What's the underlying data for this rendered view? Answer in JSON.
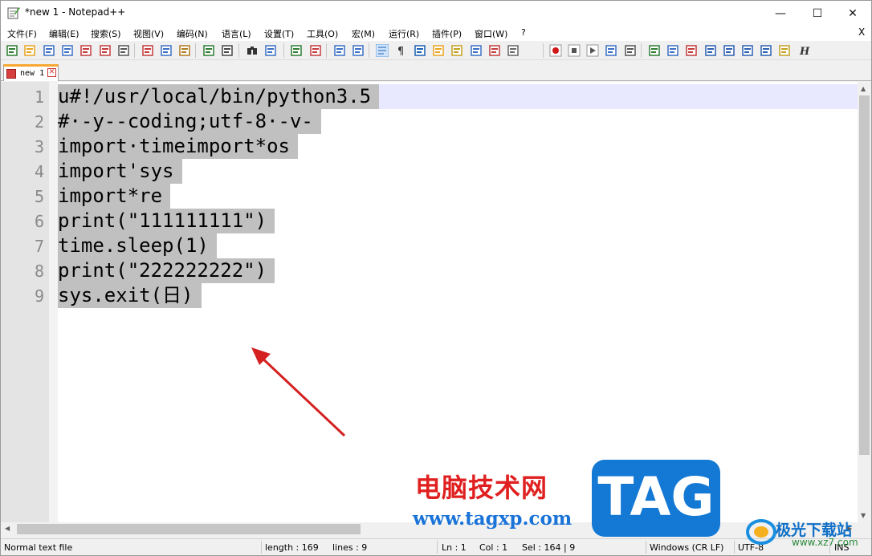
{
  "window": {
    "title": "*new 1 - Notepad++",
    "minimize_glyph": "—",
    "maximize_glyph": "☐",
    "close_glyph": "✕"
  },
  "menu": {
    "items": [
      "文件(F)",
      "编辑(E)",
      "搜索(S)",
      "视图(V)",
      "编码(N)",
      "语言(L)",
      "设置(T)",
      "工具(O)",
      "宏(M)",
      "运行(R)",
      "插件(P)",
      "窗口(W)",
      "?"
    ],
    "close_doc": "X"
  },
  "toolbar": {
    "icons": [
      "new-file-icon",
      "open-file-icon",
      "save-icon",
      "save-all-icon",
      "close-icon",
      "close-all-icon",
      "print-icon",
      "cut-icon",
      "copy-icon",
      "paste-icon",
      "undo-icon",
      "redo-icon",
      "find-icon",
      "replace-icon",
      "zoom-in-icon",
      "zoom-out-icon",
      "sync-vertical-icon",
      "sync-horizontal-icon",
      "word-wrap-icon",
      "show-all-chars-icon",
      "indent-guide-icon",
      "language-icon",
      "doc-map-icon",
      "function-list-icon",
      "folder-workspace-icon",
      "monitoring-icon",
      "record-macro-icon",
      "stop-record-icon",
      "play-macro-icon",
      "run-macro-multiple-icon",
      "save-macro-icon",
      "plugin-1-icon",
      "plugin-2-icon",
      "plugin-3-icon",
      "plugin-4-icon",
      "plugin-5-icon",
      "plugin-6-icon",
      "plugin-7-icon",
      "plugin-8-icon",
      "plugin-9-icon"
    ]
  },
  "tabs": [
    {
      "label": "new 1",
      "close": "✕"
    }
  ],
  "editor": {
    "lines": [
      {
        "num": "1",
        "text": "u#!/usr/local/bin/python3.5"
      },
      {
        "num": "2",
        "text": "#·-y--coding;utf-8·-v-"
      },
      {
        "num": "3",
        "text": "import·timeimport*os"
      },
      {
        "num": "4",
        "text": "import'sys"
      },
      {
        "num": "5",
        "text": "import*re"
      },
      {
        "num": "6",
        "text": "print(\"111111111\")"
      },
      {
        "num": "7",
        "text": "time.sleep(1)"
      },
      {
        "num": "8",
        "text": "print(\"222222222\")"
      },
      {
        "num": "9",
        "text": "sys.exit(日)"
      }
    ]
  },
  "status": {
    "file_type": "Normal text file",
    "length": "length : 169",
    "lines": "lines : 9",
    "ln": "Ln : 1",
    "col": "Col : 1",
    "sel": "Sel : 164 | 9",
    "eol": "Windows (CR LF)",
    "encoding": "UTF-8",
    "mode": "INS"
  },
  "watermark": {
    "cn_text": "电脑技术网",
    "url": "www.tagxp.com",
    "tag": "TAG",
    "site_name": "极光下载站",
    "site_url": "www.xz7.com"
  },
  "colors": {
    "selection": "#c0c0c0",
    "current_line": "#e8e8ff",
    "annotation_arrow": "#d42020",
    "tab_accent": "#f7a832"
  }
}
